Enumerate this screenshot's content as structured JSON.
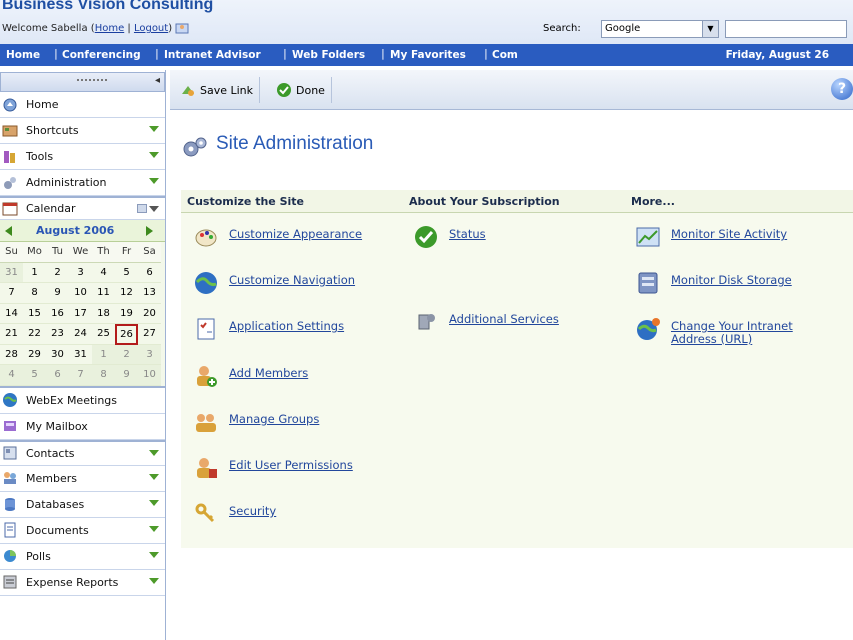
{
  "header": {
    "brand": "Business Vision Consulting",
    "welcome_name": "Welcome Sabella",
    "link_home": "Home",
    "link_logout": "Logout",
    "search_label": "Search:",
    "search_engine": "Google"
  },
  "nav": {
    "items": [
      "Home",
      "Conferencing",
      "Intranet Advisor",
      "Web Folders",
      "My Favorites",
      "Com"
    ],
    "date": "Friday, August 26"
  },
  "sidebar": {
    "top_items": [
      {
        "label": "Home",
        "icon": "home-icon"
      },
      {
        "label": "Shortcuts",
        "icon": "shortcuts-icon",
        "dropdown": true
      },
      {
        "label": "Tools",
        "icon": "tools-icon",
        "dropdown": true
      },
      {
        "label": "Administration",
        "icon": "administration-icon",
        "dropdown": true
      }
    ],
    "calendar": {
      "label": "Calendar",
      "month": "August 2006",
      "dow": [
        "Su",
        "Mo",
        "Tu",
        "We",
        "Th",
        "Fr",
        "Sa"
      ],
      "days": [
        [
          "31",
          "1",
          "2",
          "3",
          "4",
          "5",
          "6"
        ],
        [
          "7",
          "8",
          "9",
          "10",
          "11",
          "12",
          "13"
        ],
        [
          "14",
          "15",
          "16",
          "17",
          "18",
          "19",
          "20"
        ],
        [
          "21",
          "22",
          "23",
          "24",
          "25",
          "26",
          "27"
        ],
        [
          "28",
          "29",
          "30",
          "31",
          "1",
          "2",
          "3"
        ],
        [
          "4",
          "5",
          "6",
          "7",
          "8",
          "9",
          "10"
        ]
      ],
      "today": "26"
    },
    "bottom_items": [
      {
        "label": "WebEx Meetings",
        "icon": "webex-icon"
      },
      {
        "label": "My Mailbox",
        "icon": "mailbox-icon"
      },
      {
        "label": "Contacts",
        "icon": "contacts-icon",
        "dropdown": true
      },
      {
        "label": "Members",
        "icon": "members-icon",
        "dropdown": true
      },
      {
        "label": "Databases",
        "icon": "databases-icon",
        "dropdown": true
      },
      {
        "label": "Documents",
        "icon": "documents-icon",
        "dropdown": true
      },
      {
        "label": "Polls",
        "icon": "polls-icon",
        "dropdown": true
      },
      {
        "label": "Expense Reports",
        "icon": "expense-icon",
        "dropdown": true
      }
    ]
  },
  "toolbar": {
    "save_link": "Save Link",
    "done": "Done"
  },
  "page": {
    "title": "Site Administration"
  },
  "columns": {
    "customize": {
      "heading": "Customize the Site",
      "links": [
        "Customize Appearance",
        "Customize Navigation",
        "Application Settings",
        "Add Members",
        "Manage Groups",
        "Edit User Permissions",
        "Security"
      ]
    },
    "subscription": {
      "heading": "About Your Subscription",
      "links": [
        "Status",
        "Additional Services"
      ]
    },
    "more": {
      "heading": "More...",
      "links": [
        "Monitor Site Activity",
        "Monitor Disk Storage",
        "Change Your Intranet Address (URL)"
      ]
    }
  },
  "colors": {
    "nav_bar": "#2a5cc0",
    "title_blue": "#2a5bb6",
    "link_blue": "#22479c",
    "panel_bg": "#f7faee"
  }
}
